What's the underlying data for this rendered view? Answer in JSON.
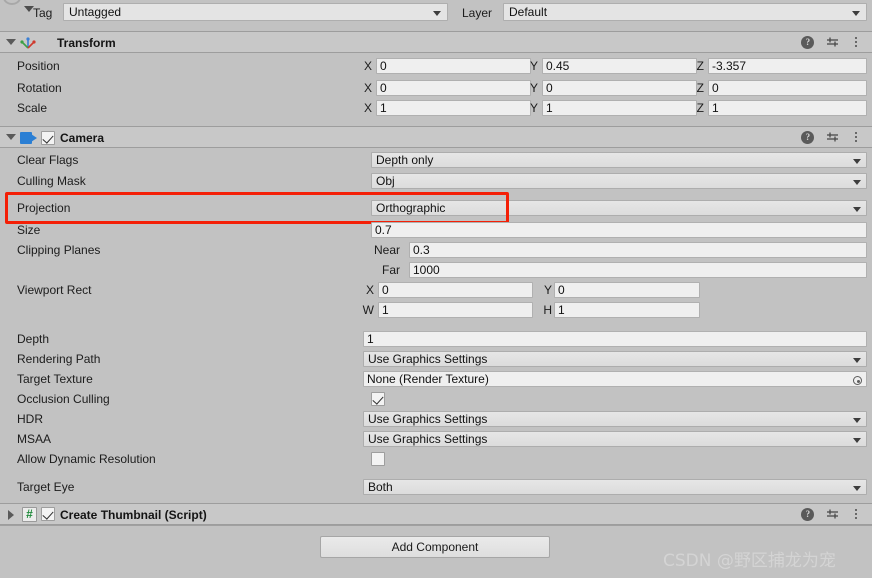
{
  "window": {
    "title": "Unity Inspector",
    "background": "#c2c2c2",
    "highlight_color": "#f41f06"
  },
  "top_strip": {
    "tag_label": "Tag",
    "tag_value": "Untagged",
    "layer_label": "Layer",
    "layer_value": "Default"
  },
  "transform": {
    "title": "Transform",
    "icon": "transform-axis-icon",
    "expanded": true,
    "rows": [
      {
        "label": "Position",
        "x": "0",
        "y": "0.45",
        "z": "-3.357"
      },
      {
        "label": "Rotation",
        "x": "0",
        "y": "0",
        "z": "0"
      },
      {
        "label": "Scale",
        "x": "1",
        "y": "1",
        "z": "1"
      }
    ],
    "axis_labels": {
      "x": "X",
      "y": "Y",
      "z": "Z"
    },
    "header_icons": {
      "help": "?",
      "preset": "preset-icon",
      "menu": "more-menu-icon"
    }
  },
  "camera": {
    "title": "Camera",
    "icon": "camera-icon",
    "enabled": true,
    "expanded": true,
    "clear_flags": {
      "label": "Clear Flags",
      "value": "Depth only"
    },
    "culling_mask": {
      "label": "Culling Mask",
      "value": "Obj"
    },
    "projection": {
      "label": "Projection",
      "value": "Orthographic",
      "highlighted": true
    },
    "size": {
      "label": "Size",
      "value": "0.7"
    },
    "clipping_planes": {
      "label": "Clipping Planes",
      "near_label": "Near",
      "near_value": "0.3",
      "far_label": "Far",
      "far_value": "1000"
    },
    "viewport_rect": {
      "label": "Viewport Rect",
      "x_label": "X",
      "x_value": "0",
      "y_label": "Y",
      "y_value": "0",
      "w_label": "W",
      "w_value": "1",
      "h_label": "H",
      "h_value": "1"
    },
    "depth": {
      "label": "Depth",
      "value": "1"
    },
    "rendering_path": {
      "label": "Rendering Path",
      "value": "Use Graphics Settings"
    },
    "target_texture": {
      "label": "Target Texture",
      "value": "None (Render Texture)"
    },
    "occlusion_culling": {
      "label": "Occlusion Culling",
      "checked": true
    },
    "hdr": {
      "label": "HDR",
      "value": "Use Graphics Settings"
    },
    "msaa": {
      "label": "MSAA",
      "value": "Use Graphics Settings"
    },
    "allow_dynamic_resolution": {
      "label": "Allow Dynamic Resolution",
      "checked": false
    },
    "target_eye": {
      "label": "Target Eye",
      "value": "Both"
    }
  },
  "script_component": {
    "title": "Create Thumbnail (Script)",
    "icon_glyph": "#",
    "enabled": true,
    "expanded": false
  },
  "footer": {
    "add_component_label": "Add Component",
    "watermark": "CSDN @野区捕龙为宠"
  }
}
